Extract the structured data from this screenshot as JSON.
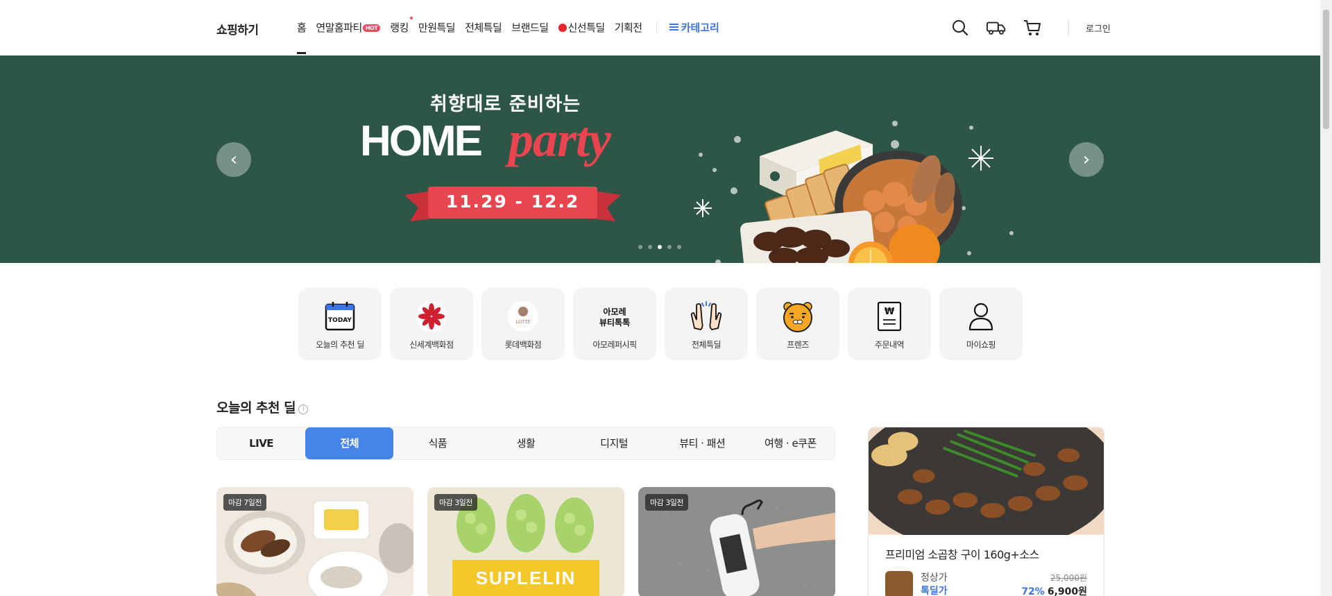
{
  "header": {
    "logo": "쇼핑하기",
    "nav": [
      {
        "label": "홈"
      },
      {
        "label": "연말홈파티",
        "badge": "HOT"
      },
      {
        "label": "랭킹"
      },
      {
        "label": "만원특딜"
      },
      {
        "label": "전체특딜"
      },
      {
        "label": "브랜드딜"
      },
      {
        "label": "신선특딜"
      },
      {
        "label": "기획전"
      }
    ],
    "category_label": "카테고리",
    "login_label": "로그인",
    "accent_color": "#3a74e8"
  },
  "banner": {
    "subtitle": "취향대로 준비하는",
    "title_main": "HOME",
    "title_script": "party",
    "dates": "11.29 - 12.2",
    "prev_arrow": "‹",
    "next_arrow": "›",
    "bg_color": "#2d5646",
    "slide_count": 5,
    "active_slide": 3
  },
  "shortcuts": [
    {
      "label": "오늘의 추천 딜",
      "icon": "today-calendar-icon"
    },
    {
      "label": "신세계백화점",
      "icon": "shinsegae-logo-icon"
    },
    {
      "label": "롯데백화점",
      "icon": "lotte-logo-icon"
    },
    {
      "label": "아모레퍼시픽",
      "icon": "amore-beauty-icon",
      "logo_text": "아모레\n뷰티톡톡"
    },
    {
      "label": "전체특딜",
      "icon": "clapping-hands-icon"
    },
    {
      "label": "프렌즈",
      "icon": "ryan-friends-icon"
    },
    {
      "label": "주문내역",
      "icon": "receipt-icon",
      "logo_text": "₩"
    },
    {
      "label": "마이쇼핑",
      "icon": "person-icon"
    }
  ],
  "section": {
    "title": "오늘의 추천 딜",
    "info_icon": "i",
    "tabs": [
      "LIVE",
      "전체",
      "식품",
      "생활",
      "디지털",
      "뷰티 · 패션",
      "여행 · e쿠폰"
    ],
    "active_tab": 1
  },
  "cards": [
    {
      "badge": "마감 7일전"
    },
    {
      "badge": "마감 3일전",
      "product_text": "SUPLELIN"
    },
    {
      "badge": "마감 3일전"
    }
  ],
  "side_deal": {
    "title": "프리미엄 소곱창 구이 160g+소스",
    "regular_label": "정상가",
    "deal_label": "톡딜가",
    "original_price": "25,000원",
    "discount": "72%",
    "price": "6,900원"
  }
}
